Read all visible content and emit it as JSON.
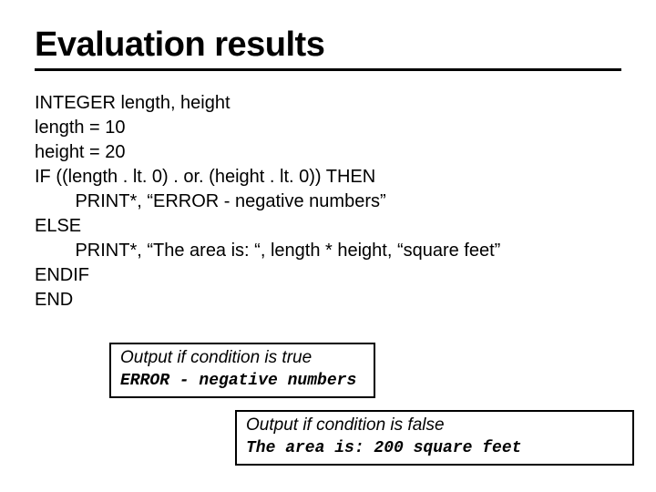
{
  "title": "Evaluation results",
  "code": {
    "l1": "INTEGER length, height",
    "l2": "length = 10",
    "l3": "height = 20",
    "l4": "IF ((length . lt. 0) . or. (height . lt. 0)) THEN",
    "l5": "        PRINT*, “ERROR - negative numbers”",
    "l6": "ELSE",
    "l7": "        PRINT*, “The area is: “, length * height, “square feet”",
    "l8": "ENDIF",
    "l9": "END"
  },
  "box1": {
    "caption": "Output if condition is true",
    "output": "ERROR - negative numbers"
  },
  "box2": {
    "caption": "Output if condition is false",
    "output": "The area is: 200 square feet"
  }
}
